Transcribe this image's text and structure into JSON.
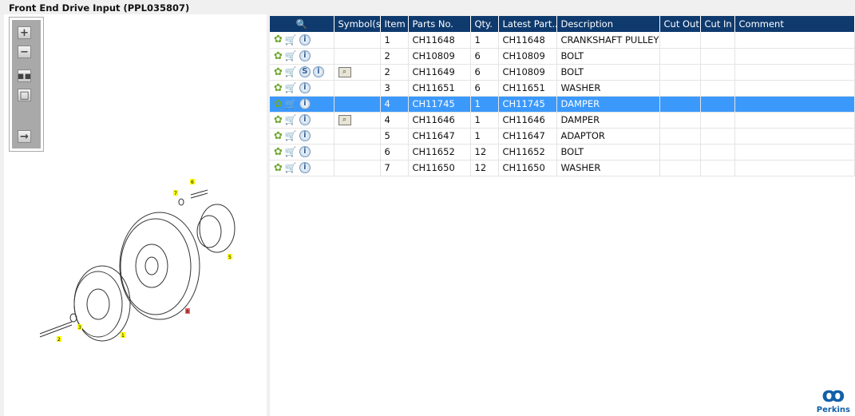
{
  "title": "Front End Drive Input (PPL035807)",
  "toolbar": {
    "icons": [
      "zoom-in-icon",
      "zoom-out-icon",
      "fit-all-icon",
      "fit-window-icon",
      "layout-toggle-icon"
    ]
  },
  "diagram": {
    "callouts": [
      "7",
      "6",
      "5",
      "8",
      "1",
      "3",
      "2"
    ]
  },
  "table": {
    "headers": [
      "",
      "Symbol(s)",
      "Item",
      "Parts No.",
      "Qty.",
      "Latest Part...",
      "Description",
      "Cut Out",
      "Cut In",
      "Comment"
    ],
    "rows": [
      {
        "s": false,
        "sym": false,
        "item": "1",
        "part": "CH11648",
        "qty": "1",
        "latest": "CH11648",
        "desc": "CRANKSHAFT PULLEY",
        "cutout": "",
        "cutin": "",
        "comment": "",
        "selected": false
      },
      {
        "s": false,
        "sym": false,
        "item": "2",
        "part": "CH10809",
        "qty": "6",
        "latest": "CH10809",
        "desc": "BOLT",
        "cutout": "",
        "cutin": "",
        "comment": "",
        "selected": false
      },
      {
        "s": true,
        "sym": true,
        "item": "2",
        "part": "CH11649",
        "qty": "6",
        "latest": "CH10809",
        "desc": "BOLT",
        "cutout": "",
        "cutin": "",
        "comment": "",
        "selected": false
      },
      {
        "s": false,
        "sym": false,
        "item": "3",
        "part": "CH11651",
        "qty": "6",
        "latest": "CH11651",
        "desc": "WASHER",
        "cutout": "",
        "cutin": "",
        "comment": "",
        "selected": false
      },
      {
        "s": false,
        "sym": false,
        "item": "4",
        "part": "CH11745",
        "qty": "1",
        "latest": "CH11745",
        "desc": "DAMPER",
        "cutout": "",
        "cutin": "",
        "comment": "",
        "selected": true
      },
      {
        "s": false,
        "sym": true,
        "item": "4",
        "part": "CH11646",
        "qty": "1",
        "latest": "CH11646",
        "desc": "DAMPER",
        "cutout": "",
        "cutin": "",
        "comment": "",
        "selected": false
      },
      {
        "s": false,
        "sym": false,
        "item": "5",
        "part": "CH11647",
        "qty": "1",
        "latest": "CH11647",
        "desc": "ADAPTOR",
        "cutout": "",
        "cutin": "",
        "comment": "",
        "selected": false
      },
      {
        "s": false,
        "sym": false,
        "item": "6",
        "part": "CH11652",
        "qty": "12",
        "latest": "CH11652",
        "desc": "BOLT",
        "cutout": "",
        "cutin": "",
        "comment": "",
        "selected": false
      },
      {
        "s": false,
        "sym": false,
        "item": "7",
        "part": "CH11650",
        "qty": "12",
        "latest": "CH11650",
        "desc": "WASHER",
        "cutout": "",
        "cutin": "",
        "comment": "",
        "selected": false
      }
    ]
  },
  "brand": "Perkins"
}
